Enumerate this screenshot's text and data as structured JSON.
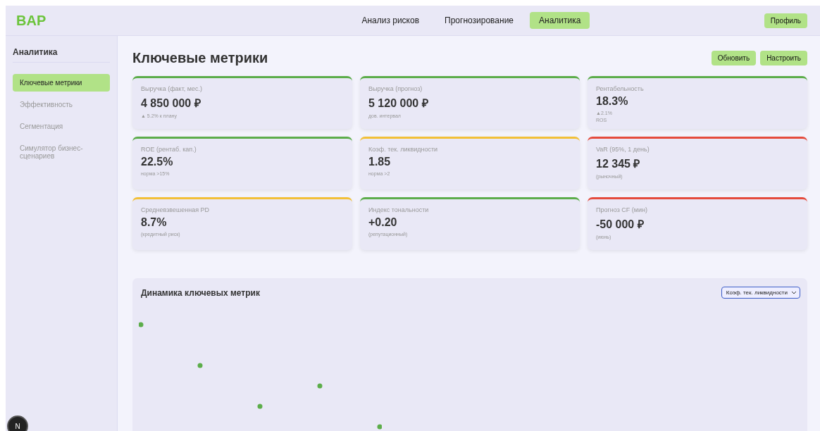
{
  "header": {
    "logo": "BAP",
    "nav": [
      {
        "label": "Анализ рисков",
        "selected": false
      },
      {
        "label": "Прогнозирование",
        "selected": false
      },
      {
        "label": "Аналитика",
        "selected": true
      }
    ],
    "profile_button": "Профиль"
  },
  "sidebar": {
    "title": "Аналитика",
    "items": [
      {
        "label": "Ключевые метрики",
        "selected": true
      },
      {
        "label": "Эффективность",
        "selected": false
      },
      {
        "label": "Сегментация",
        "selected": false
      },
      {
        "label": "Симулятор бизнес-сценариев",
        "selected": false
      }
    ]
  },
  "main": {
    "title": "Ключевые метрики",
    "buttons": [
      "Обновить",
      "Настроить"
    ],
    "metrics": [
      {
        "label": "Выручка (факт, мес.)",
        "value": "4 850 000 ₽",
        "notes": [
          "▲ 5.2% к плану"
        ],
        "color": "#5cad4a"
      },
      {
        "label": "Выручка (прогноз)",
        "value": "5 120 000 ₽",
        "notes": [
          "дов. интервал"
        ],
        "color": "#5cad4a"
      },
      {
        "label": "Рентабельность",
        "value": "18.3%",
        "notes": [
          "▲2.1%",
          "ROS"
        ],
        "color": "#5cad4a"
      },
      {
        "label": "ROE (рентаб. кап.)",
        "value": "22.5%",
        "notes": [
          "норма >15%"
        ],
        "color": "#5cad4a"
      },
      {
        "label": "Коэф. тек. ликвидности",
        "value": "1.85",
        "notes": [
          "норма >2"
        ],
        "color": "#f2c037"
      },
      {
        "label": "VaR (95%, 1 день)",
        "value": "12 345 ₽",
        "notes": [
          "(рыночный)"
        ],
        "color": "#e54b3c"
      },
      {
        "label": "Средневзвешенная PD",
        "value": "8.7%",
        "notes": [
          "(кредитный риск)"
        ],
        "color": "#f2c037"
      },
      {
        "label": "Индекс тональности",
        "value": "+0.20",
        "notes": [
          "(репутационный)"
        ],
        "color": "#5cad4a"
      },
      {
        "label": "Прогноз CF (мин)",
        "value": "-50 000 ₽",
        "notes": [
          "(июнь)"
        ],
        "color": "#e54b3c"
      }
    ],
    "chart_panel": {
      "title": "Динамика ключевых метрик",
      "select": "Коэф. тек. ликвидности"
    }
  },
  "dev_badge": "N"
}
